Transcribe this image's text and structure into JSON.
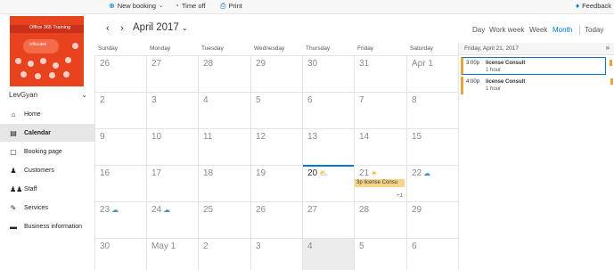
{
  "toolbar": {
    "new_booking": "New booking",
    "time_off": "Time off",
    "print": "Print",
    "feedback": "Feedback"
  },
  "sidebar": {
    "logo": {
      "text": "Office 365 Training",
      "cloud_text": "Office365"
    },
    "business_name": "LevGyan",
    "items": [
      {
        "label": "Home",
        "icon": "home-icon",
        "glyph": "⌂"
      },
      {
        "label": "Calendar",
        "icon": "calendar-icon",
        "glyph": "▤",
        "active": true
      },
      {
        "label": "Booking page",
        "icon": "booking-page-icon",
        "glyph": "▢"
      },
      {
        "label": "Customers",
        "icon": "customers-icon",
        "glyph": "♟"
      },
      {
        "label": "Staff",
        "icon": "staff-icon",
        "glyph": "♟♟"
      },
      {
        "label": "Services",
        "icon": "services-icon",
        "glyph": "✎"
      },
      {
        "label": "Business information",
        "icon": "business-info-icon",
        "glyph": "▬"
      }
    ]
  },
  "calendar": {
    "month_title": "April 2017",
    "views": [
      "Day",
      "Work week",
      "Week",
      "Month"
    ],
    "active_view": "Month",
    "today_label": "Today",
    "weekdays": [
      "Sunday",
      "Monday",
      "Tuesday",
      "Wednesday",
      "Thursday",
      "Friday",
      "Saturday"
    ],
    "weeks": [
      [
        {
          "d": "26"
        },
        {
          "d": "27"
        },
        {
          "d": "28"
        },
        {
          "d": "29"
        },
        {
          "d": "30"
        },
        {
          "d": "31"
        },
        {
          "d": "Apr 1"
        }
      ],
      [
        {
          "d": "2"
        },
        {
          "d": "3"
        },
        {
          "d": "4"
        },
        {
          "d": "5"
        },
        {
          "d": "6"
        },
        {
          "d": "7"
        },
        {
          "d": "8"
        }
      ],
      [
        {
          "d": "9"
        },
        {
          "d": "10"
        },
        {
          "d": "11"
        },
        {
          "d": "12"
        },
        {
          "d": "13"
        },
        {
          "d": "14"
        },
        {
          "d": "15"
        }
      ],
      [
        {
          "d": "16"
        },
        {
          "d": "17"
        },
        {
          "d": "18"
        },
        {
          "d": "19"
        },
        {
          "d": "20",
          "today": true,
          "wx": "partly-cloudy"
        },
        {
          "d": "21",
          "wx": "sun",
          "event": "3p license Consu",
          "more": "+1"
        },
        {
          "d": "22",
          "wx": "cloud"
        }
      ],
      [
        {
          "d": "23",
          "wx": "cloud"
        },
        {
          "d": "24",
          "wx": "cloud"
        },
        {
          "d": "25"
        },
        {
          "d": "26"
        },
        {
          "d": "27"
        },
        {
          "d": "28"
        },
        {
          "d": "29"
        }
      ],
      [
        {
          "d": "30"
        },
        {
          "d": "May 1"
        },
        {
          "d": "2"
        },
        {
          "d": "3"
        },
        {
          "d": "4",
          "shaded": true
        },
        {
          "d": "5"
        },
        {
          "d": "6"
        }
      ]
    ]
  },
  "panel": {
    "date": "Friday, April 21, 2017",
    "events": [
      {
        "time": "3:00p",
        "title": "license Consult",
        "duration": "1 hour",
        "selected": true
      },
      {
        "time": "4:00p",
        "title": "license Consult",
        "duration": "1 hour",
        "selected": false
      }
    ]
  },
  "colors": {
    "accent": "#0078d4",
    "event": "#f7d48a",
    "event_bar": "#e8a33a",
    "logo_bg": "#e8431f"
  }
}
